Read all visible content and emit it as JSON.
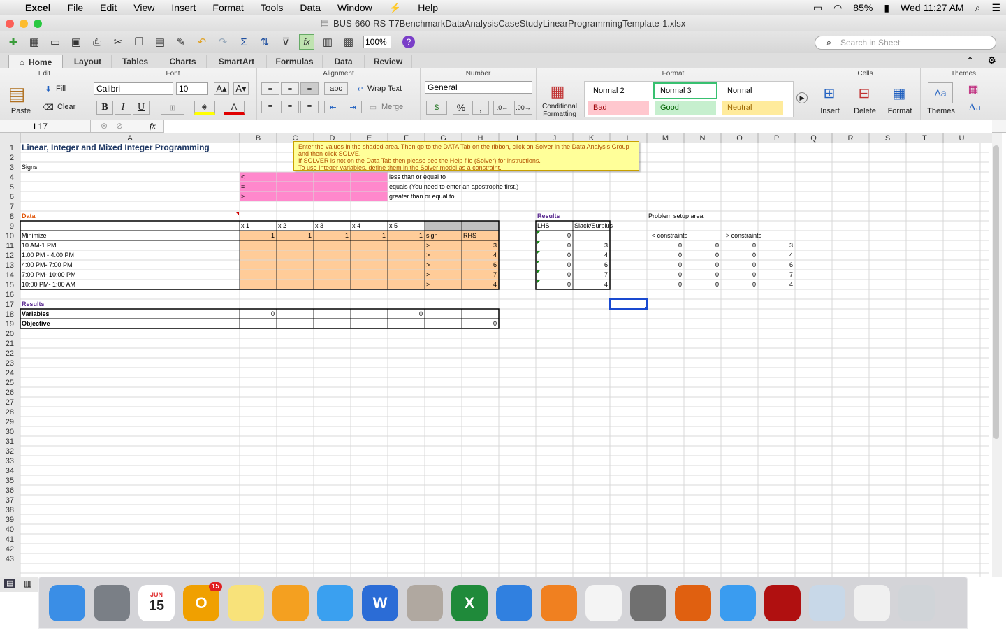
{
  "menubar": {
    "apple": "",
    "app": "Excel",
    "items": [
      "File",
      "Edit",
      "View",
      "Insert",
      "Format",
      "Tools",
      "Data",
      "Window",
      "Help"
    ],
    "battery": "85%",
    "clock": "Wed 11:27 AM"
  },
  "window": {
    "title": "BUS-660-RS-T7BenchmarkDataAnalysisCaseStudyLinearProgrammingTemplate-1.xlsx"
  },
  "toolbar": {
    "zoom": "100%",
    "search_placeholder": "Search in Sheet"
  },
  "ribbon_tabs": [
    "Home",
    "Layout",
    "Tables",
    "Charts",
    "SmartArt",
    "Formulas",
    "Data",
    "Review"
  ],
  "ribbon": {
    "edit": {
      "title": "Edit",
      "paste": "Paste",
      "fill": "Fill",
      "clear": "Clear"
    },
    "font": {
      "title": "Font",
      "name": "Calibri",
      "size": "10",
      "bold": "B",
      "italic": "I",
      "underline": "U"
    },
    "alignment": {
      "title": "Alignment",
      "wrap": "Wrap Text",
      "merge": "Merge",
      "abc": "abc"
    },
    "number": {
      "title": "Number",
      "format": "General",
      "percent": "%",
      "comma": ","
    },
    "format": {
      "title": "Format",
      "cond": "Conditional Formatting",
      "styles": [
        {
          "label": "Normal 2",
          "bg": "#ffffff",
          "color": "#000000"
        },
        {
          "label": "Normal 3",
          "bg": "#ffffff",
          "color": "#000000"
        },
        {
          "label": "Normal",
          "bg": "#ffffff",
          "color": "#000000"
        },
        {
          "label": "Bad",
          "bg": "#ffc7ce",
          "color": "#9c0006"
        },
        {
          "label": "Good",
          "bg": "#c6efce",
          "color": "#006100"
        },
        {
          "label": "Neutral",
          "bg": "#ffeb9c",
          "color": "#9c6500"
        }
      ]
    },
    "cells": {
      "title": "Cells",
      "insert": "Insert",
      "delete": "Delete",
      "format": "Format"
    },
    "themes": {
      "title": "Themes",
      "themes": "Themes",
      "aa": "Aa"
    }
  },
  "formula_bar": {
    "cell_ref": "L17",
    "fx": "fx"
  },
  "columns": [
    "A",
    "B",
    "C",
    "D",
    "E",
    "F",
    "G",
    "H",
    "I",
    "J",
    "K",
    "L",
    "M",
    "N",
    "O",
    "P",
    "Q",
    "R",
    "S",
    "T",
    "U"
  ],
  "tooltip_lines": [
    "Enter the values in the shaded area.  Then go to the DATA Tab on the ribbon, click on Solver in the Data Analysis Group and then click SOLVE.",
    "If SOLVER is not on the Data Tab then please see the Help file (Solver) for instructions.",
    "To use Integer variables, define them in the Solver model as a constraint."
  ],
  "cells_text": [
    {
      "c": "A",
      "r": 1,
      "t": "Linear, Integer and Mixed Integer Programming",
      "s": "title"
    },
    {
      "c": "A",
      "r": 3,
      "t": "Signs"
    },
    {
      "c": "B",
      "r": 4,
      "t": "<"
    },
    {
      "c": "B",
      "r": 5,
      "t": "="
    },
    {
      "c": "B",
      "r": 6,
      "t": ">"
    },
    {
      "c": "F",
      "r": 4,
      "t": "less than or equal to"
    },
    {
      "c": "F",
      "r": 5,
      "t": "equals (You need to enter an apostrophe first.)"
    },
    {
      "c": "F",
      "r": 6,
      "t": "greater than or equal to"
    },
    {
      "c": "A",
      "r": 8,
      "t": "Data",
      "s": "orange"
    },
    {
      "c": "J",
      "r": 8,
      "t": "Results",
      "s": "purple"
    },
    {
      "c": "M",
      "r": 8,
      "t": "Problem setup area"
    },
    {
      "c": "B",
      "r": 9,
      "t": "x 1"
    },
    {
      "c": "C",
      "r": 9,
      "t": "x 2"
    },
    {
      "c": "D",
      "r": 9,
      "t": "x 3"
    },
    {
      "c": "E",
      "r": 9,
      "t": "x 4"
    },
    {
      "c": "F",
      "r": 9,
      "t": "x 5"
    },
    {
      "c": "J",
      "r": 9,
      "t": "LHS"
    },
    {
      "c": "K",
      "r": 9,
      "t": "Slack/Surplus"
    },
    {
      "c": "A",
      "r": 10,
      "t": "Minimize"
    },
    {
      "c": "B",
      "r": 10,
      "t": "1",
      "a": "r"
    },
    {
      "c": "C",
      "r": 10,
      "t": "1",
      "a": "r"
    },
    {
      "c": "D",
      "r": 10,
      "t": "1",
      "a": "r"
    },
    {
      "c": "E",
      "r": 10,
      "t": "1",
      "a": "r"
    },
    {
      "c": "F",
      "r": 10,
      "t": "1",
      "a": "r"
    },
    {
      "c": "G",
      "r": 10,
      "t": "sign"
    },
    {
      "c": "H",
      "r": 10,
      "t": "RHS"
    },
    {
      "c": "J",
      "r": 10,
      "t": "0",
      "a": "r"
    },
    {
      "c": "M",
      "r": 10,
      "t": "< constraints",
      "a": "c"
    },
    {
      "c": "O",
      "r": 10,
      "t": "> constraints",
      "a": "c"
    },
    {
      "c": "A",
      "r": 11,
      "t": "10 AM-1 PM"
    },
    {
      "c": "A",
      "r": 12,
      "t": "1:00 PM - 4:00 PM"
    },
    {
      "c": "A",
      "r": 13,
      "t": "4:00 PM- 7:00 PM"
    },
    {
      "c": "A",
      "r": 14,
      "t": "7:00 PM- 10:00 PM"
    },
    {
      "c": "A",
      "r": 15,
      "t": "10:00 PM- 1:00 AM"
    },
    {
      "c": "G",
      "r": 11,
      "t": ">"
    },
    {
      "c": "G",
      "r": 12,
      "t": ">"
    },
    {
      "c": "G",
      "r": 13,
      "t": ">"
    },
    {
      "c": "G",
      "r": 14,
      "t": ">"
    },
    {
      "c": "G",
      "r": 15,
      "t": ">"
    },
    {
      "c": "H",
      "r": 11,
      "t": "3",
      "a": "r"
    },
    {
      "c": "H",
      "r": 12,
      "t": "4",
      "a": "r"
    },
    {
      "c": "H",
      "r": 13,
      "t": "6",
      "a": "r"
    },
    {
      "c": "H",
      "r": 14,
      "t": "7",
      "a": "r"
    },
    {
      "c": "H",
      "r": 15,
      "t": "4",
      "a": "r"
    },
    {
      "c": "J",
      "r": 11,
      "t": "0",
      "a": "r"
    },
    {
      "c": "J",
      "r": 12,
      "t": "0",
      "a": "r"
    },
    {
      "c": "J",
      "r": 13,
      "t": "0",
      "a": "r"
    },
    {
      "c": "J",
      "r": 14,
      "t": "0",
      "a": "r"
    },
    {
      "c": "J",
      "r": 15,
      "t": "0",
      "a": "r"
    },
    {
      "c": "K",
      "r": 11,
      "t": "3",
      "a": "r"
    },
    {
      "c": "K",
      "r": 12,
      "t": "4",
      "a": "r"
    },
    {
      "c": "K",
      "r": 13,
      "t": "6",
      "a": "r"
    },
    {
      "c": "K",
      "r": 14,
      "t": "7",
      "a": "r"
    },
    {
      "c": "K",
      "r": 15,
      "t": "4",
      "a": "r"
    },
    {
      "c": "M",
      "r": 11,
      "t": "0",
      "a": "r"
    },
    {
      "c": "N",
      "r": 11,
      "t": "0",
      "a": "r"
    },
    {
      "c": "O",
      "r": 11,
      "t": "0",
      "a": "r"
    },
    {
      "c": "P",
      "r": 11,
      "t": "3",
      "a": "r"
    },
    {
      "c": "M",
      "r": 12,
      "t": "0",
      "a": "r"
    },
    {
      "c": "N",
      "r": 12,
      "t": "0",
      "a": "r"
    },
    {
      "c": "O",
      "r": 12,
      "t": "0",
      "a": "r"
    },
    {
      "c": "P",
      "r": 12,
      "t": "4",
      "a": "r"
    },
    {
      "c": "M",
      "r": 13,
      "t": "0",
      "a": "r"
    },
    {
      "c": "N",
      "r": 13,
      "t": "0",
      "a": "r"
    },
    {
      "c": "O",
      "r": 13,
      "t": "0",
      "a": "r"
    },
    {
      "c": "P",
      "r": 13,
      "t": "6",
      "a": "r"
    },
    {
      "c": "M",
      "r": 14,
      "t": "0",
      "a": "r"
    },
    {
      "c": "N",
      "r": 14,
      "t": "0",
      "a": "r"
    },
    {
      "c": "O",
      "r": 14,
      "t": "0",
      "a": "r"
    },
    {
      "c": "P",
      "r": 14,
      "t": "7",
      "a": "r"
    },
    {
      "c": "M",
      "r": 15,
      "t": "0",
      "a": "r"
    },
    {
      "c": "N",
      "r": 15,
      "t": "0",
      "a": "r"
    },
    {
      "c": "O",
      "r": 15,
      "t": "0",
      "a": "r"
    },
    {
      "c": "P",
      "r": 15,
      "t": "4",
      "a": "r"
    },
    {
      "c": "A",
      "r": 17,
      "t": "Results",
      "s": "purple"
    },
    {
      "c": "A",
      "r": 18,
      "t": "Variables",
      "s": "bold"
    },
    {
      "c": "B",
      "r": 18,
      "t": "0",
      "a": "r"
    },
    {
      "c": "F",
      "r": 18,
      "t": "0",
      "a": "r"
    },
    {
      "c": "A",
      "r": 19,
      "t": "Objective",
      "s": "bold"
    },
    {
      "c": "H",
      "r": 19,
      "t": "0",
      "a": "r"
    }
  ],
  "dock": [
    {
      "name": "finder-icon",
      "label": "",
      "bg": "#3a8ee6"
    },
    {
      "name": "launchpad-icon",
      "label": "",
      "bg": "#7a7f86"
    },
    {
      "name": "calendar-icon",
      "label": "15",
      "bg": "#ffffff",
      "month": "JUN"
    },
    {
      "name": "outlook-icon",
      "label": "O",
      "bg": "#f0a000",
      "badge": "15"
    },
    {
      "name": "notes-icon",
      "label": "",
      "bg": "#f8e27a"
    },
    {
      "name": "pages-icon",
      "label": "",
      "bg": "#f4a020"
    },
    {
      "name": "messages-icon",
      "label": "",
      "bg": "#3aa0f0"
    },
    {
      "name": "word-icon",
      "label": "W",
      "bg": "#2b6cd6"
    },
    {
      "name": "calculator-icon",
      "label": "",
      "bg": "#b0a8a0"
    },
    {
      "name": "excel-icon",
      "label": "X",
      "bg": "#1f8a3a"
    },
    {
      "name": "keynote-icon",
      "label": "",
      "bg": "#3080e0"
    },
    {
      "name": "ibooks-icon",
      "label": "",
      "bg": "#f08020"
    },
    {
      "name": "photos-icon",
      "label": "",
      "bg": "#f4f4f4"
    },
    {
      "name": "system-preferences-icon",
      "label": "",
      "bg": "#707070"
    },
    {
      "name": "firefox-icon",
      "label": "",
      "bg": "#e06010"
    },
    {
      "name": "safari-icon",
      "label": "",
      "bg": "#3a9cf0"
    },
    {
      "name": "acrobat-icon",
      "label": "",
      "bg": "#b01010"
    },
    {
      "name": "bubbles-icon",
      "label": "",
      "bg": "#c8d8e8"
    },
    {
      "name": "document-icon",
      "label": "",
      "bg": "#f0f0f0"
    },
    {
      "name": "trash-icon",
      "label": "",
      "bg": "#d0d4d8"
    }
  ]
}
